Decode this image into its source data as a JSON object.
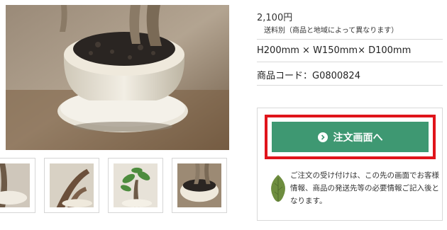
{
  "product": {
    "price": "2,100円",
    "shipping_note": "送料別（商品と地域によって異なります）",
    "dimensions": "H200mm × W150mm× D100mm",
    "code": "商品コード：G0800824"
  },
  "order": {
    "button_label": "注文画面へ",
    "note": "ご注文の受け付けは、この先の画面でお客様情報、商品の発送先等の必要情報ご記入後となります。"
  },
  "colors": {
    "button": "#3e9872",
    "highlight": "#e0141b",
    "divider": "#d9d9d9"
  },
  "icons": {
    "button": "chevron-right-circle-icon",
    "note": "leaf-icon"
  }
}
